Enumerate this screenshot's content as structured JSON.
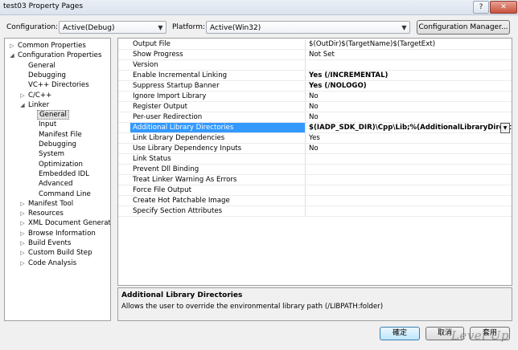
{
  "window": {
    "title": "test03 Property Pages",
    "help": "?",
    "close": "✕"
  },
  "toolbar": {
    "configuration_label": "Configuration:",
    "configuration_value": "Active(Debug)",
    "platform_label": "Platform:",
    "platform_value": "Active(Win32)",
    "config_manager": "Configuration Manager..."
  },
  "tree": [
    {
      "label": "Common Properties",
      "exp": "▷"
    },
    {
      "label": "Configuration Properties",
      "exp": "◢"
    },
    {
      "label": "General",
      "exp": ""
    },
    {
      "label": "Debugging",
      "exp": ""
    },
    {
      "label": "VC++ Directories",
      "exp": ""
    },
    {
      "label": "C/C++",
      "exp": "▷"
    },
    {
      "label": "Linker",
      "exp": "◢"
    },
    {
      "label": "General",
      "exp": ""
    },
    {
      "label": "Input",
      "exp": ""
    },
    {
      "label": "Manifest File",
      "exp": ""
    },
    {
      "label": "Debugging",
      "exp": ""
    },
    {
      "label": "System",
      "exp": ""
    },
    {
      "label": "Optimization",
      "exp": ""
    },
    {
      "label": "Embedded IDL",
      "exp": ""
    },
    {
      "label": "Advanced",
      "exp": ""
    },
    {
      "label": "Command Line",
      "exp": ""
    },
    {
      "label": "Manifest Tool",
      "exp": "▷"
    },
    {
      "label": "Resources",
      "exp": "▷"
    },
    {
      "label": "XML Document Generator",
      "exp": "▷"
    },
    {
      "label": "Browse Information",
      "exp": "▷"
    },
    {
      "label": "Build Events",
      "exp": "▷"
    },
    {
      "label": "Custom Build Step",
      "exp": "▷"
    },
    {
      "label": "Code Analysis",
      "exp": "▷"
    }
  ],
  "properties": [
    {
      "name": "Output File",
      "value": "$(OutDir)$(TargetName)$(TargetExt)"
    },
    {
      "name": "Show Progress",
      "value": "Not Set"
    },
    {
      "name": "Version",
      "value": ""
    },
    {
      "name": "Enable Incremental Linking",
      "value": "Yes (/INCREMENTAL)"
    },
    {
      "name": "Suppress Startup Banner",
      "value": "Yes (/NOLOGO)"
    },
    {
      "name": "Ignore Import Library",
      "value": "No"
    },
    {
      "name": "Register Output",
      "value": "No"
    },
    {
      "name": "Per-user Redirection",
      "value": "No"
    },
    {
      "name": "Additional Library Directories",
      "value": "$(IADP_SDK_DIR)\\Cpp\\Lib;%(AdditionalLibraryDirectories)"
    },
    {
      "name": "Link Library Dependencies",
      "value": "Yes"
    },
    {
      "name": "Use Library Dependency Inputs",
      "value": "No"
    },
    {
      "name": "Link Status",
      "value": ""
    },
    {
      "name": "Prevent Dll Binding",
      "value": ""
    },
    {
      "name": "Treat Linker Warning As Errors",
      "value": ""
    },
    {
      "name": "Force File Output",
      "value": ""
    },
    {
      "name": "Create Hot Patchable Image",
      "value": ""
    },
    {
      "name": "Specify Section Attributes",
      "value": ""
    }
  ],
  "description": {
    "title": "Additional Library Directories",
    "text": "Allows the user to override the environmental library path (/LIBPATH:folder)"
  },
  "buttons": {
    "ok": "確定",
    "cancel": "取消",
    "apply": "套用"
  },
  "watermark": "Level Up"
}
